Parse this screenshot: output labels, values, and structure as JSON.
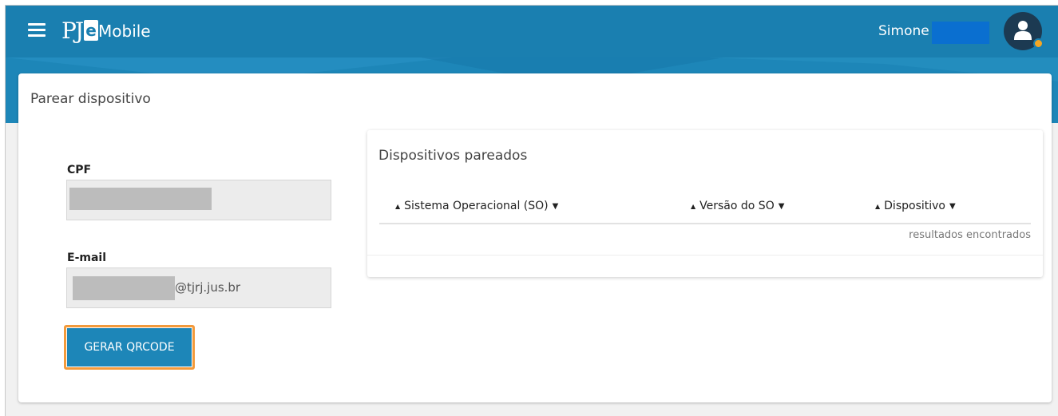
{
  "header": {
    "logo_text": "PJ",
    "logo_e": "e",
    "app_name": "Mobile",
    "user_name": "Simone",
    "menu_icon": "hamburger-menu-icon",
    "avatar_icon": "user-avatar-icon"
  },
  "page": {
    "title": "Parear dispositivo"
  },
  "form": {
    "cpf_label": "CPF",
    "cpf_value": "",
    "email_label": "E-mail",
    "email_suffix": "@tjrj.jus.br",
    "generate_button": "GERAR QRCODE"
  },
  "devices": {
    "title": "Dispositivos pareados",
    "columns": [
      "Sistema Operacional (SO)",
      "Versão do SO",
      "Dispositivo"
    ],
    "results_text": "resultados encontrados"
  },
  "colors": {
    "header": "#1a7fb0",
    "button": "#1d86b8",
    "highlight": "#f39a3b",
    "status_dot": "#f5a623"
  }
}
